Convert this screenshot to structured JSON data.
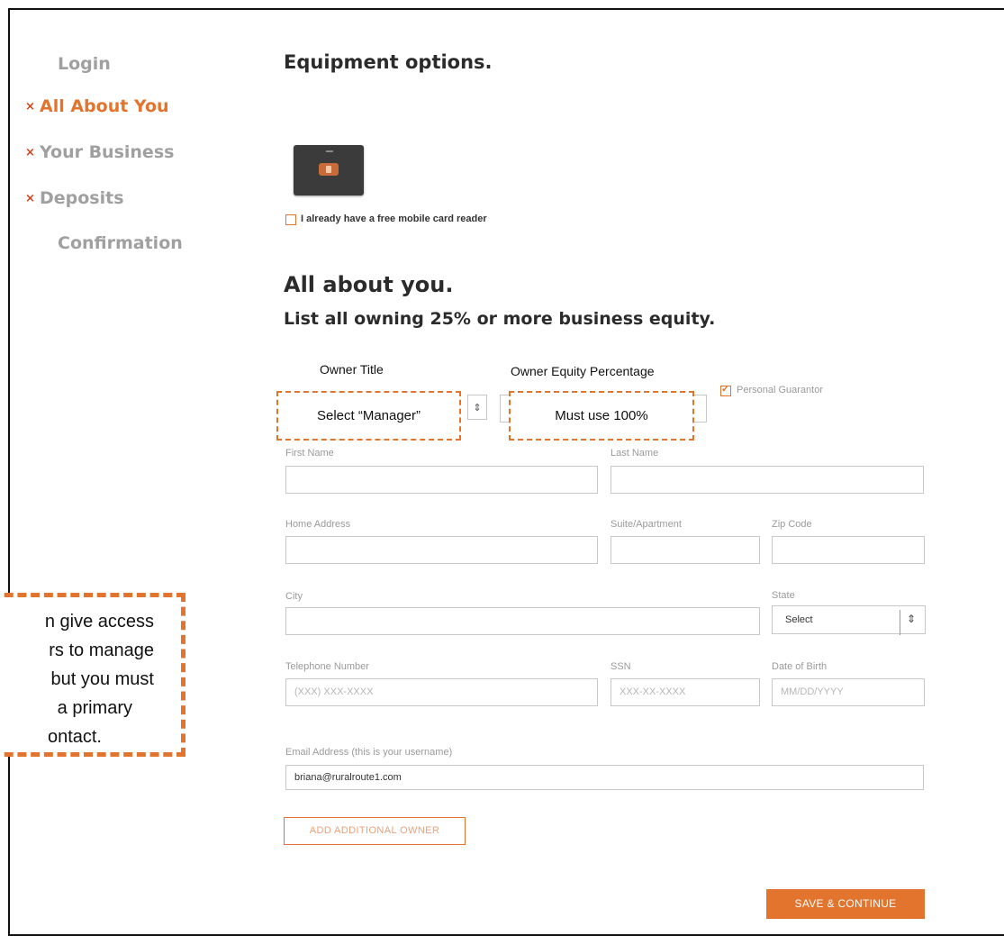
{
  "nav": {
    "items": [
      {
        "label": "Login",
        "marker": ""
      },
      {
        "label": "All About You",
        "marker": "×"
      },
      {
        "label": "Your Business",
        "marker": "×"
      },
      {
        "label": "Deposits",
        "marker": "×"
      },
      {
        "label": "Confirmation",
        "marker": ""
      }
    ]
  },
  "equipment": {
    "heading": "Equipment options.",
    "free_reader_label": "I already have a free mobile card reader"
  },
  "about": {
    "heading": "All about you.",
    "subheading": "List all owning 25% or more business equity."
  },
  "annotations": {
    "owner_title_label": "Owner Title",
    "owner_title_box": "Select “Manager”",
    "equity_label": "Owner Equity Percentage",
    "equity_box": "Must use 100%",
    "callout_lines": [
      "n give access",
      "rs to manage",
      "but you must",
      "a primary",
      "ontact."
    ]
  },
  "form": {
    "personal_guarantor": "Personal Guarantor",
    "first_name": "First Name",
    "last_name": "Last Name",
    "home_address": "Home Address",
    "suite": "Suite/Apartment",
    "zip": "Zip Code",
    "city": "City",
    "state": "State",
    "state_value": "Select",
    "telephone": "Telephone Number",
    "telephone_placeholder": "(XXX) XXX-XXXX",
    "ssn": "SSN",
    "ssn_placeholder": "XXX-XX-XXXX",
    "dob": "Date of Birth",
    "dob_placeholder": "MM/DD/YYYY",
    "email": "Email Address (this is your username)",
    "email_value": "briana@ruralroute1.com",
    "add_owner": "ADD ADDITIONAL OWNER",
    "save_continue": "SAVE & CONTINUE"
  },
  "colors": {
    "accent": "#e2742d",
    "marker": "#d0441f",
    "nav_inactive": "#a0a0a0"
  },
  "icons": {
    "stepper": "updown-arrows-icon",
    "check": "check-icon",
    "reader": "card-reader-icon"
  }
}
